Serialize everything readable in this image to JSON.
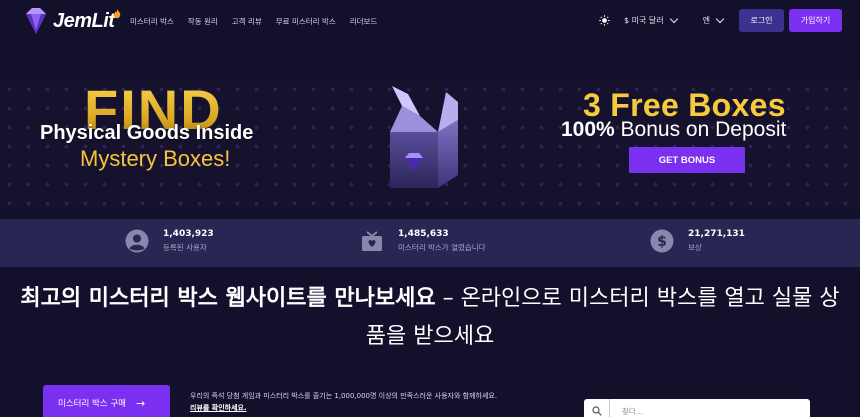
{
  "header": {
    "logo_text": "JemLit",
    "nav": [
      "미스터리 박스",
      "작동 원리",
      "고객 리뷰",
      "무료 미스터리 박스",
      "리더보드"
    ],
    "currency": "$ 미국 달러",
    "language": "엔",
    "login_label": "로그인",
    "signup_label": "가입하기"
  },
  "banner": {
    "find": "FIND",
    "line1": "Physical Goods Inside",
    "line2": "Mystery Boxes!",
    "free_boxes": "3 Free Boxes",
    "bonus_bold": "100%",
    "bonus_rest": " Bonus on Deposit",
    "cta": "GET BONUS"
  },
  "stats": [
    {
      "value": "1,403,923",
      "label": "등록된 사용자",
      "icon": "user-icon"
    },
    {
      "value": "1,485,633",
      "label": "미스터리 박스가 열렸습니다",
      "icon": "gift-box-icon"
    },
    {
      "value": "21,271,131",
      "label": "보상",
      "icon": "dollar-icon"
    }
  ],
  "headline": {
    "bold": "최고의 미스터리 박스 웹사이트를 만나보세요",
    "rest": " – 온라인으로 미스터리 박스를 열고 실물 상품을 받으세요"
  },
  "bottom": {
    "buy_label": "미스터리 박스 구매",
    "description": "우리의 즉석 당첨 게임과 미스터리 박스를 즐기는 1,000,000명 이상의 만족스러운 사용자와 함께하세요.",
    "review_link": "리뷰를 확인하세요.",
    "search_placeholder": "찾다..."
  },
  "colors": {
    "background": "#13102b",
    "accent": "#7b2ff0",
    "login_bg": "#3c318c",
    "stats_bar": "#282653",
    "gold": "#f6ca3e"
  }
}
